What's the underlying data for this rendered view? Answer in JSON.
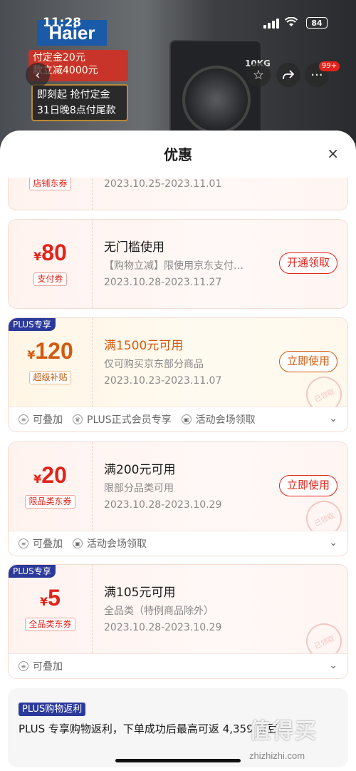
{
  "status_bar": {
    "time": "11:28",
    "battery": "84"
  },
  "background": {
    "brand": "Haier",
    "promo_line1": "付定金20元",
    "promo_line2": "款立减4000元",
    "promo_line3": "即刻起 抢付定金",
    "promo_line4": "31日晚8点付尾款",
    "capacity_tag": "10KG",
    "cart_badge": "99+"
  },
  "sheet": {
    "title": "优惠",
    "close": "×"
  },
  "coupons": [
    {
      "type_label": "店铺东券",
      "date": "2023.10.25-2023.11.01"
    },
    {
      "amount": "80",
      "currency": "¥",
      "type_label": "支付券",
      "title": "无门槛使用",
      "desc": "【购物立减】限使用京东支付…",
      "date": "2023.10.28-2023.11.27",
      "button": "开通领取"
    },
    {
      "plus_tag": "PLUS专享",
      "amount": "120",
      "currency": "¥",
      "type_label": "超级补贴",
      "title": "满1500元可用",
      "desc": "仅可购买京东部分商品",
      "date": "2023.10.23-2023.11.07",
      "button": "立即使用",
      "stamp": "已领取",
      "features": [
        "可叠加",
        "PLUS正式会员专享",
        "活动会场领取"
      ]
    },
    {
      "amount": "20",
      "currency": "¥",
      "type_label": "限品类东券",
      "title": "满200元可用",
      "desc": "限部分品类可用",
      "date": "2023.10.28-2023.10.29",
      "button": "立即使用",
      "stamp": "已领取",
      "features": [
        "可叠加",
        "活动会场领取"
      ]
    },
    {
      "plus_tag": "PLUS专享",
      "amount": "5",
      "currency": "¥",
      "type_label": "全品类东券",
      "title": "满105元可用",
      "desc": "全品类（特例商品除外）",
      "date": "2023.10.28-2023.10.29",
      "stamp": "已领取",
      "features": [
        "可叠加"
      ]
    }
  ],
  "rebate": {
    "tag": "PLUS购物返利",
    "text": "PLUS 专享购物返利，下单成功后最高可返 4,359 京豆"
  },
  "watermark": {
    "big": "值得买",
    "site": "zhizhizhi.com"
  }
}
